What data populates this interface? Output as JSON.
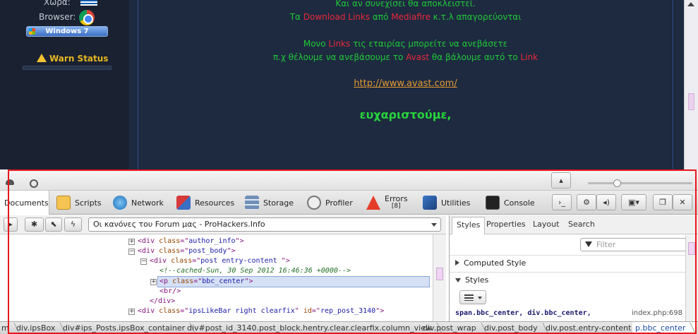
{
  "site": {
    "sidebar": {
      "country_label": "Χώρα:",
      "browser_label": "Browser:",
      "os_button": "Windows 7",
      "warn_status": "Warn Status"
    },
    "post": {
      "line1": "Και αν συνεχίσει θα αποκλειστεί.",
      "line2_a": "Τα ",
      "line2_b": "Download Links",
      "line2_c": " από ",
      "line2_d": "Mediafire",
      "line2_e": " κ.τ.λ απαγορεύονται",
      "line3_a": "Μονο ",
      "line3_b": "Links",
      "line3_c": " τις εταιρίας μπορείτε να ανεβάσετε",
      "line4_a": "π.χ θέλουμε να ανεβάσουμε το ",
      "line4_b": "Avast",
      "line4_c": " θα βάλουμε αυτό το ",
      "line4_d": "Link",
      "link": "http://www.avast.com/",
      "thanks": "ευχαριστούμε,"
    }
  },
  "devtools": {
    "tabs": [
      {
        "label": "Documents",
        "icon": "documents-icon"
      },
      {
        "label": "Scripts",
        "icon": "scripts-icon"
      },
      {
        "label": "Network",
        "icon": "network-icon"
      },
      {
        "label": "Resources",
        "icon": "resources-icon"
      },
      {
        "label": "Storage",
        "icon": "storage-icon"
      },
      {
        "label": "Profiler",
        "icon": "profiler-icon"
      },
      {
        "label": "Errors",
        "count": "[8]",
        "icon": "errors-icon"
      },
      {
        "label": "Utilities",
        "icon": "utilities-icon"
      },
      {
        "label": "Console",
        "icon": "console-icon"
      }
    ],
    "document_select": "Οι κανόνες του Forum μας - ProHackers.Info",
    "dom": [
      {
        "tag": "div",
        "attr": "class",
        "val": "author_info"
      },
      {
        "tag": "div",
        "attr": "class",
        "val": "post_body"
      },
      {
        "tag": "div",
        "attr": "class",
        "val": "post entry-content "
      },
      {
        "comment": "<!--cached-Sun, 30 Sep 2012 16:46:36 +0000-->"
      },
      {
        "tag": "p",
        "attr": "class",
        "val": "bbc_center"
      },
      {
        "text": "<br/>"
      },
      {
        "text": "</div>"
      },
      {
        "tag": "div",
        "attr": "class",
        "val": "ipsLikeBar right clearfix",
        "attr2": "id",
        "val2": "rep_post_3140"
      }
    ],
    "side_tabs": [
      "Styles",
      "Properties",
      "Layout",
      "Search"
    ],
    "filter_placeholder": "Filter",
    "computed_style": "Computed Style",
    "styles": "Styles",
    "rule_selector": "span.bbc_center, div.bbc_center,",
    "rule_source": "index.php:698",
    "breadcrumbs": [
      "m",
      "div.ipsBox",
      "div#ips_Posts.ipsBox_container",
      "div#post_id_3140.post_block.hentry.clear.clearfix.column_view",
      "div.post_wrap",
      "div.post_body",
      "div.post.entry-content",
      "p.bbc_center"
    ]
  },
  "colors": {
    "highlight": "#e8151b",
    "text_green": "#21c838",
    "text_red": "#e9283b"
  }
}
